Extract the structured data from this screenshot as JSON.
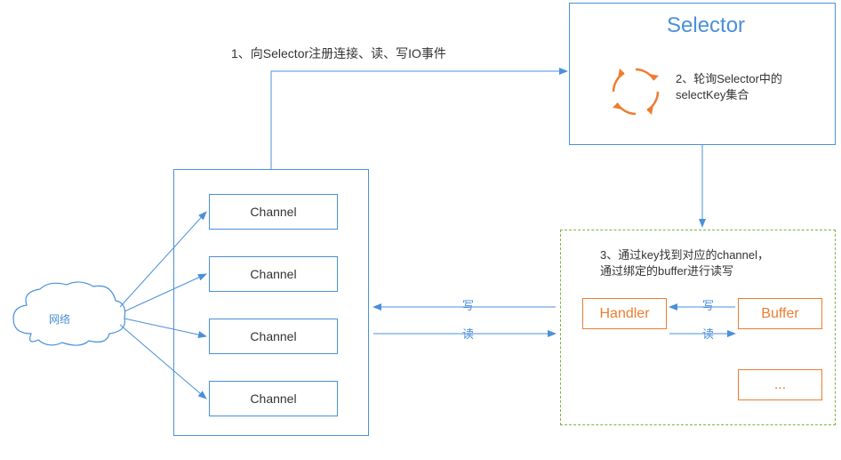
{
  "network_label": "网络",
  "channels": [
    "Channel",
    "Channel",
    "Channel",
    "Channel"
  ],
  "selector_title": "Selector",
  "step1": "1、向Selector注册连接、读、写IO事件",
  "step2_line1": "2、轮询Selector中的",
  "step2_line2": "selectKey集合",
  "step3_line1": "3、通过key找到对应的channel，",
  "step3_line2": "通过绑定的buffer进行读写",
  "handler_label": "Handler",
  "buffer_label": "Buffer",
  "dots_label": "...",
  "write_label": "写",
  "read_label": "读"
}
